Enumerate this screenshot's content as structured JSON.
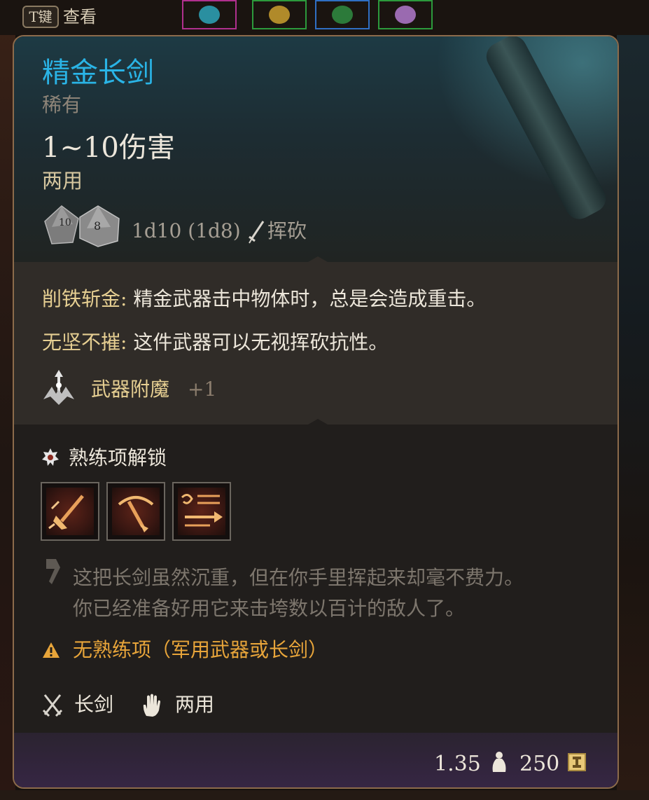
{
  "hud": {
    "hotkey": "T键",
    "view_label": "查看"
  },
  "item": {
    "name": "精金长剑",
    "rarity": "稀有",
    "damage": "1~10伤害",
    "handedness": "两用",
    "dice_roll": "1d10 (1d8)",
    "damage_type": "挥砍",
    "dice_faces": [
      "10",
      "8"
    ]
  },
  "properties": [
    {
      "name": "削铁斩金:",
      "text": " 精金武器击中物体时，总是会造成重击。"
    },
    {
      "name": "无坚不摧:",
      "text": " 这件武器可以无视挥砍抗性。"
    }
  ],
  "enchantment": {
    "label": "武器附魔",
    "value": "+1"
  },
  "proficiency": {
    "title": "熟练项解锁",
    "skills": [
      "weapon-action-1",
      "weapon-action-2",
      "weapon-action-3"
    ]
  },
  "description": {
    "line1": "这把长剑虽然沉重，但在你手里挥起来却毫不费力。",
    "line2": "你已经准备好用它来击垮数以百计的敌人了。"
  },
  "warning": "无熟练项（军用武器或长剑）",
  "tags": [
    {
      "icon": "crossed-swords-icon",
      "label": "长剑"
    },
    {
      "icon": "hand-icon",
      "label": "两用"
    }
  ],
  "footer": {
    "weight": "1.35",
    "price": "250"
  },
  "colors": {
    "title": "#2ab4e6",
    "warning": "#e8a53a",
    "property_name": "#e6cf92",
    "border": "#8c6b4b"
  }
}
